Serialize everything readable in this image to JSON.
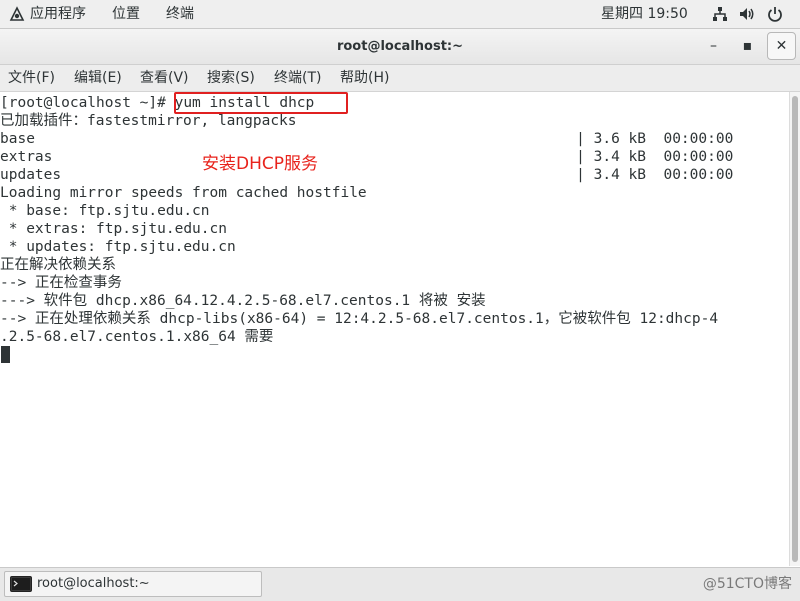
{
  "top_panel": {
    "apps_label": "应用程序",
    "places_label": "位置",
    "terminal_label": "终端",
    "clock": "星期四 19:50"
  },
  "window": {
    "title": "root@localhost:~",
    "minimize_glyph": "–",
    "maximize_glyph": "▪",
    "close_glyph": "✕"
  },
  "menu": {
    "items": [
      "文件(F)",
      "编辑(E)",
      "查看(V)",
      "搜索(S)",
      "终端(T)",
      "帮助(H)"
    ]
  },
  "terminal": {
    "lines": [
      "[root@localhost ~]# yum install dhcp",
      "已加载插件：fastestmirror, langpacks",
      "base                                                              | 3.6 kB  00:00:00",
      "extras                                                            | 3.4 kB  00:00:00",
      "updates                                                           | 3.4 kB  00:00:00",
      "Loading mirror speeds from cached hostfile",
      " * base: ftp.sjtu.edu.cn",
      " * extras: ftp.sjtu.edu.cn",
      " * updates: ftp.sjtu.edu.cn",
      "正在解决依赖关系",
      "--> 正在检查事务",
      "---> 软件包 dhcp.x86_64.12.4.2.5-68.el7.centos.1 将被 安装",
      "--> 正在处理依赖关系 dhcp-libs(x86-64) = 12:4.2.5-68.el7.centos.1，它被软件包 12:dhcp-4",
      ".2.5-68.el7.centos.1.x86_64 需要"
    ],
    "annotation": "安装DHCP服务"
  },
  "taskbar": {
    "window_label": "root@localhost:~",
    "watermark": "@51CTO博客"
  },
  "colors": {
    "annotation": "#e8231c",
    "highlight_box": "#e02020",
    "terminal_fg": "#2e3436"
  }
}
